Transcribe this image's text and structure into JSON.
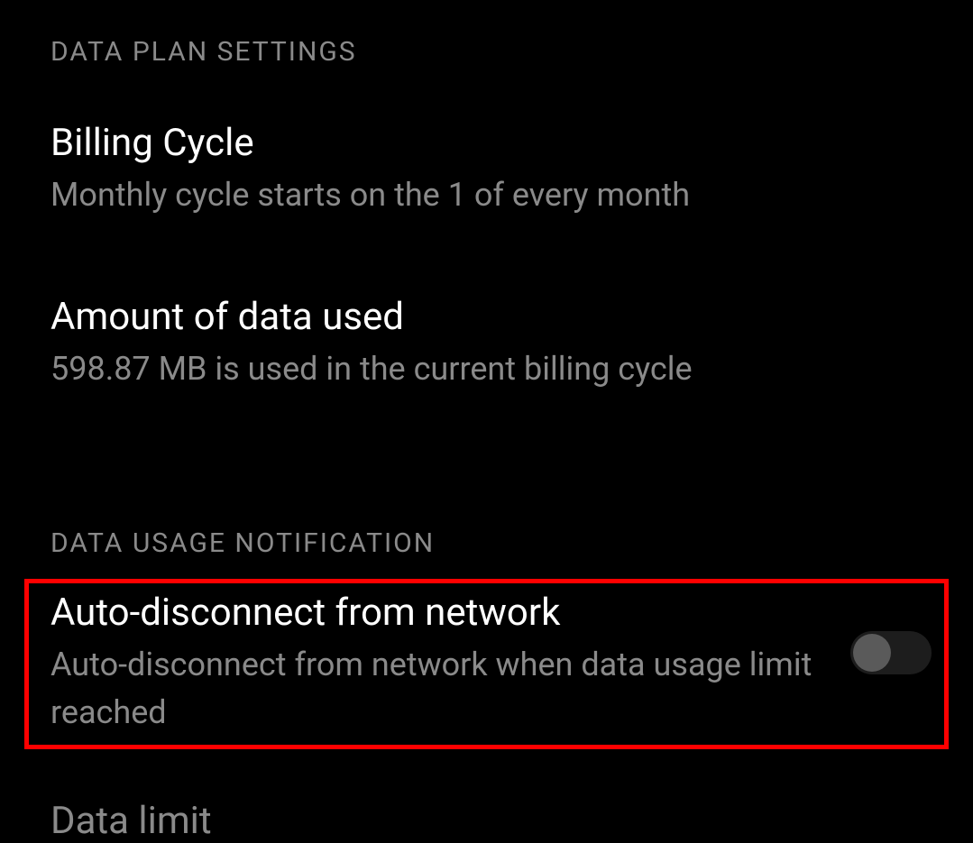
{
  "sections": {
    "data_plan": {
      "header": "DATA PLAN SETTINGS",
      "billing_cycle": {
        "title": "Billing Cycle",
        "subtitle": "Monthly cycle starts on the 1 of every month"
      },
      "amount_used": {
        "title": "Amount of data used",
        "subtitle": " 598.87 MB is used in the current billing cycle"
      }
    },
    "data_usage_notification": {
      "header": "DATA USAGE NOTIFICATION",
      "auto_disconnect": {
        "title": "Auto-disconnect from network",
        "subtitle": "Auto-disconnect from network when data usage limit reached",
        "enabled": false
      },
      "data_limit": {
        "title": "Data limit"
      }
    }
  }
}
